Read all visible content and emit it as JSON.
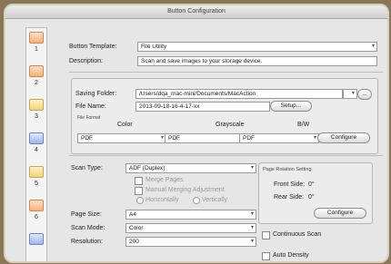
{
  "window": {
    "title": "Button Configuration"
  },
  "sidebar": {
    "items": [
      {
        "num": "1",
        "icon": "folder-icon"
      },
      {
        "num": "2",
        "icon": "folder-icon"
      },
      {
        "num": "3",
        "icon": "printer-icon"
      },
      {
        "num": "4",
        "icon": "folder-icon"
      },
      {
        "num": "5",
        "icon": "folder-icon"
      },
      {
        "num": "6",
        "icon": "folder-icon"
      }
    ]
  },
  "template": {
    "label": "Button Template:",
    "value": "File Utility"
  },
  "description": {
    "label": "Description:",
    "value": "Scan and save images to your storage device."
  },
  "saving": {
    "folder_label": "Saving Folder:",
    "folder_value": "/Users/dqa_mac-mini/Documents/MacAction",
    "folder_btn": "...",
    "file_label": "File Name:",
    "file_value": "2013-09-18-16-4-17-xx",
    "setup_btn": "Setup..."
  },
  "file_format": {
    "group_label": "File Format",
    "color_label": "Color",
    "gray_label": "Grayscale",
    "bw_label": "B/W",
    "color_value": "PDF",
    "gray_value": "PDF",
    "bw_value": "PDF",
    "configure_btn": "Configure"
  },
  "scan": {
    "type_label": "Scan Type:",
    "type_value": "ADF (Duplex)",
    "merge_pages": "Merge Pages",
    "manual_merge": "Manual Merging Adjustment",
    "horizontally": "Horizontally",
    "vertically": "Vertically",
    "page_size_label": "Page Size:",
    "page_size_value": "A4",
    "scan_mode_label": "Scan Mode:",
    "scan_mode_value": "Color",
    "resolution_label": "Resolution:",
    "resolution_value": "200"
  },
  "page_rotation": {
    "title": "Page Rotation Setting",
    "front_label": "Front Side:",
    "front_value": "0°",
    "rear_label": "Rear Side:",
    "rear_value": "0°",
    "configure_btn": "Configure"
  },
  "continuous_scan": "Continuous Scan",
  "auto_density": "Auto Density"
}
